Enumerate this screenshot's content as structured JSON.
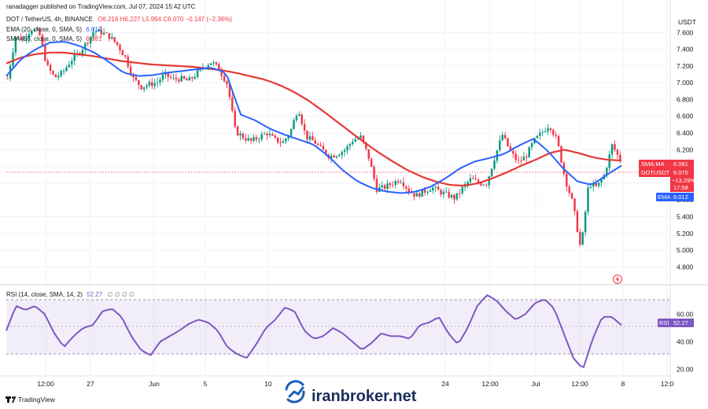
{
  "header": {
    "publisher": "ranadagger published on TradingView.com, Jul 07, 2024 15:42 UTC"
  },
  "legend": {
    "symbol": "DOT / TetherUS, 4h, BINANCE",
    "ohlc": "O6.216 H6.227 L5.994 C6.070 −0.147 (−2.36%)",
    "ema_label": "EMA (20, close, 0, SMA, 5)",
    "ema_value": "6.012",
    "sma_label": "SMA (50, close, 0, SMA, 5)",
    "sma_value": "6.081",
    "rsi_label": "RSI (14, close, SMA, 14, 2)",
    "rsi_value": "52.27",
    "rsi_extra": "∅ ∅ ∅ ∅"
  },
  "currency": "USDT",
  "price_badges": {
    "sma_name": "SMA:MA",
    "sma_value": "6.081",
    "pair": "DOTUSDT",
    "last_value": "6.070",
    "change_pct": "−13.29%",
    "countdown": "17:58",
    "ema_name": "EMA",
    "ema_value": "6.012",
    "rsi_name": "RSI",
    "rsi_value": "52.27"
  },
  "watermark": "iranbroker.net",
  "footer": {
    "brand": "TradingView"
  },
  "colors": {
    "up": "#089981",
    "down": "#f23645",
    "ema": "#2962ff",
    "sma": "#e53935",
    "rsi": "#7e57c2",
    "rsi_band": "#7e57c2"
  },
  "chart_data": {
    "type": "candlestick",
    "price_ticks": [
      "7.600",
      "7.400",
      "7.200",
      "7.000",
      "6.800",
      "6.600",
      "6.400",
      "6.200",
      "6.000",
      "5.800",
      "5.600",
      "5.400",
      "5.200",
      "5.000",
      "4.800"
    ],
    "price_range": [
      4.7,
      7.8
    ],
    "rsi_ticks": [
      "60.00",
      "40.00",
      "20.00"
    ],
    "rsi_range": [
      15,
      78
    ],
    "rsi_bands": [
      70,
      30
    ],
    "x_labels": [
      "12:00",
      "27",
      "Jun",
      "5",
      "10",
      "24",
      "12:00",
      "Jul",
      "12:00",
      "8",
      "12:0"
    ],
    "price_path": [
      7.05,
      7.55,
      7.52,
      7.64,
      7.6,
      7.2,
      7.06,
      7.12,
      7.26,
      7.35,
      7.47,
      7.62,
      7.6,
      7.55,
      7.45,
      7.3,
      7.05,
      6.95,
      6.98,
      7.0,
      7.1,
      7.04,
      7.05,
      7.02,
      7.1,
      7.2,
      7.25,
      7.15,
      6.98,
      6.42,
      6.35,
      6.3,
      6.35,
      6.4,
      6.32,
      6.28,
      6.41,
      6.7,
      6.35,
      6.3,
      6.2,
      6.12,
      6.15,
      6.2,
      6.32,
      6.35,
      6.1,
      5.73,
      5.75,
      5.8,
      5.85,
      5.72,
      5.65,
      5.7,
      5.75,
      5.7,
      5.66,
      5.62,
      5.75,
      5.85,
      5.8,
      5.8,
      6.1,
      6.38,
      6.18,
      6.05,
      6.12,
      6.3,
      6.4,
      6.5,
      6.3,
      5.85,
      5.55,
      5.0,
      5.8,
      5.75,
      5.9,
      6.26,
      6.07
    ],
    "sma_path": [
      7.23,
      7.3,
      7.34,
      7.36,
      7.36,
      7.34,
      7.32,
      7.29,
      7.26,
      7.24,
      7.22,
      7.21,
      7.2,
      7.19,
      7.17,
      7.15,
      7.12,
      7.08,
      7.04,
      6.98,
      6.9,
      6.8,
      6.68,
      6.55,
      6.42,
      6.29,
      6.17,
      6.06,
      5.96,
      5.88,
      5.82,
      5.78,
      5.77,
      5.8,
      5.86,
      5.93,
      6.01,
      6.08,
      6.16,
      6.2,
      6.16,
      6.11,
      6.08,
      6.07
    ],
    "ema_path": [
      7.08,
      7.28,
      7.4,
      7.48,
      7.49,
      7.44,
      7.36,
      7.25,
      7.12,
      7.08,
      7.09,
      7.12,
      7.14,
      7.16,
      7.18,
      7.12,
      6.62,
      6.55,
      6.45,
      6.38,
      6.32,
      6.26,
      6.12,
      5.95,
      5.82,
      5.74,
      5.7,
      5.68,
      5.7,
      5.76,
      5.86,
      5.98,
      6.06,
      6.1,
      6.15,
      6.25,
      6.33,
      6.18,
      5.98,
      5.82,
      5.78,
      5.9,
      6.01
    ],
    "rsi_path": [
      48,
      66,
      63,
      66,
      60,
      46,
      36,
      44,
      50,
      52,
      62,
      64,
      58,
      44,
      34,
      30,
      40,
      44,
      48,
      53,
      56,
      54,
      48,
      36,
      31,
      28,
      38,
      50,
      56,
      65,
      62,
      48,
      42,
      44,
      50,
      46,
      40,
      34,
      39,
      46,
      44,
      44,
      42,
      52,
      54,
      58,
      46,
      38,
      50,
      66,
      74,
      70,
      62,
      56,
      60,
      68,
      71,
      64,
      46,
      28,
      20,
      42,
      58,
      58,
      52
    ],
    "last_price": 6.07,
    "sma_last": 6.081,
    "ema_last": 6.012,
    "rsi_last": 52.27
  }
}
